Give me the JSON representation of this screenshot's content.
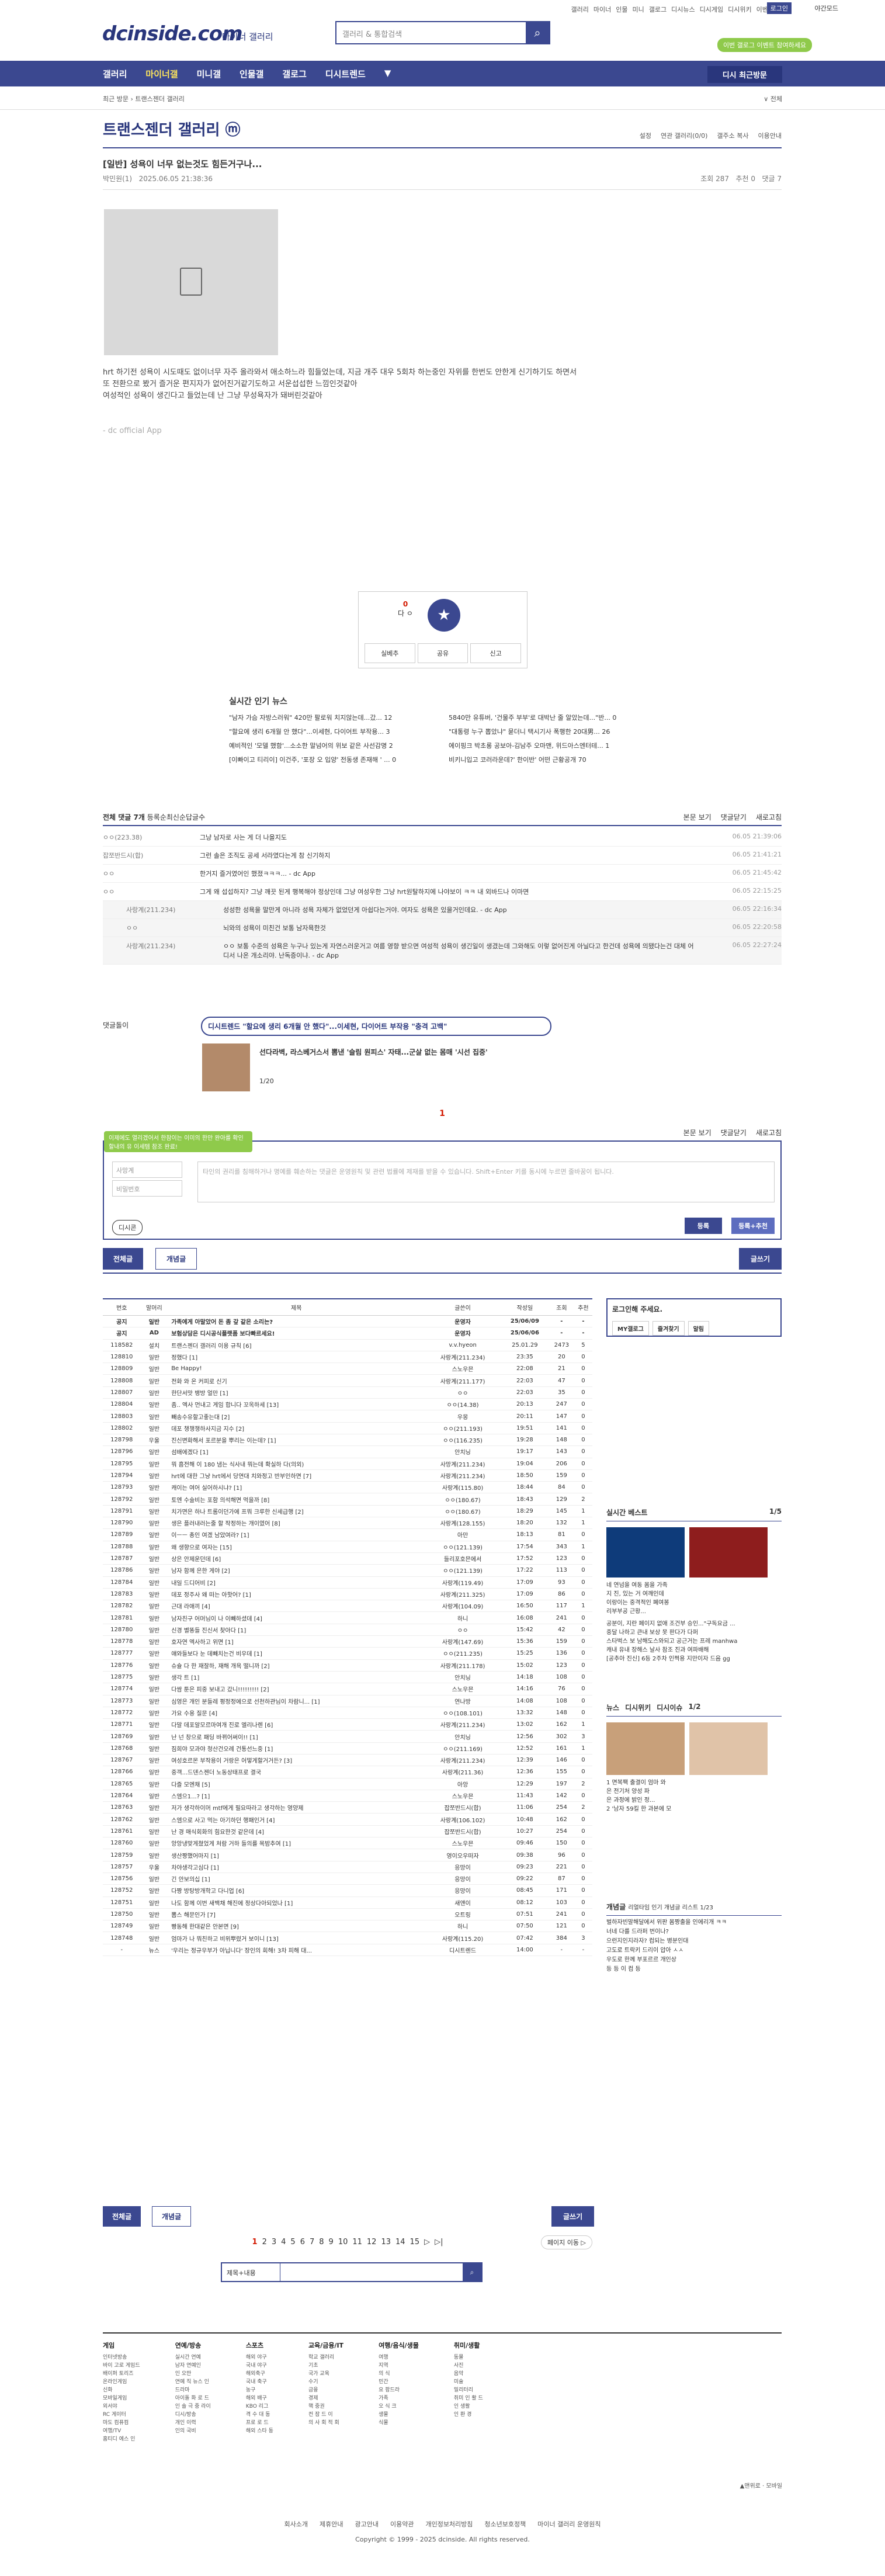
{
  "top": {
    "links": [
      "갤러리",
      "마이너",
      "인물",
      "미니",
      "갤로그",
      "디시뉴스",
      "디시게임",
      "디시위키",
      "이벤트"
    ],
    "login": "로그인",
    "night": "야간모드",
    "promo": "이번 갤로그 이벤트 참여하세요"
  },
  "header": {
    "logo": "dcinside.com",
    "sub": "마이너 갤러리",
    "search_placeholder": "갤러리 & 통합검색"
  },
  "gnb": {
    "items": [
      "갤러리",
      "마이너갤",
      "미니갤",
      "인물갤",
      "갤로그",
      "디시트렌드",
      "▼"
    ],
    "history": "디시 최근방문"
  },
  "crumb": "최근 방문  ›  트랜스젠더 갤러리",
  "gallery_title": "트랜스젠더 갤러리 ⓜ",
  "sort": [
    "설정",
    "연관 갤러리(0/0)",
    "갤주소 복사",
    "이용안내"
  ],
  "post": {
    "title": "[일반] 성욕이 너무 없는것도 힘든거구나...",
    "author": "박민원(1)",
    "date": "2025.06.05 21:38:36",
    "views": "조회 287",
    "rec": "추천 0",
    "cmt": "댓글 7",
    "body": [
      "hrt 하기전 성욕이 시도때도 없이너무 자주 올라와서 애소하느라 힘들었는데, 지금 개주 대우 5회차 하는중인 자위를 한번도 안한게 신기하기도 하면서",
      "또 전환으로 봤거 즐거운 편지자가 없어진거같기도하고 서운섭섭한 느낌인것같아",
      "여성적인 성욕이 생긴다고 들었는데 난 그냥 무성욕자가 돼버린것같아"
    ],
    "app": "- dc official App"
  },
  "rec": {
    "down": "0",
    "down_lbl": "다 ㅇ",
    "up_lbl": "개념",
    "btns": [
      "실베추",
      "공유",
      "신고"
    ]
  },
  "news": {
    "title": "실시간 인기 뉴스",
    "items": [
      "\"남자 가슴 자방스러워\" 420만 팔로워 치지않는데...갔... 12",
      "5840만 유튜버, '건물주 부부'로 대박난 줄 알았는데...\"반... 0",
      "\"할요에 생리 6개월 안 했다\"...이세현, 다이어트 부작용... 3",
      "\"대통령 누구 뽑았냐\" 묻더니 택시기사 폭행한 20대男... 26",
      "예비적인 '모델 했함'...소소한 말넘어의 위보 같은 사선감명 2",
      "에이핑크 박초롱 공보아-김남주 오마맨, 위드아스엔터테... 1",
      "[이빠이고 티리이] 이건주, '포장 오 입양' 전동생 존재해 ' ... 0",
      "비키니입고 코러라운데?' 한이반' 어떤 근황공개 70"
    ]
  },
  "comments": {
    "head": "전체 댓글 7개",
    "sort": [
      "등록순",
      "최신순",
      "답글수"
    ],
    "right": [
      "본문 보기",
      "댓글닫기",
      "새로고침"
    ],
    "rows": [
      [
        "ㅇㅇ(223.38)",
        "그냥 남자로 사는 게 더 나을지도",
        "06.05 21:39:06",
        false
      ],
      [
        "잡쪼반드시(합)",
        "그런 솔은 조직도 공세 서라였다는게 참 신기하지",
        "06.05 21:41:21",
        false
      ],
      [
        "ㅇㅇ",
        "한거지 즐거였어인 했졌ㅋㅋㅋ... - dc App",
        "06.05 21:45:42",
        false
      ],
      [
        "ㅇㅇ",
        "그게 왜 섭섭하지? 그냥 깨끗 된게 행복해야 정상인데   그냥 여성우한 그냥 hrt원탈하지에 나야보이 ㅋㅋ 내 외바드나 이마면",
        "06.05 22:15:25",
        false
      ],
      [
        "사랑계(211.234)",
        "성성한 성욕을 말만게 아니라 성욕 자체가 없었던게 아쉽다는거야. 여자도 성욕은 있을거인데요.  - dc App",
        "06.05 22:16:34",
        true
      ],
      [
        "ㅇㅇ",
        "뇌와의 성욕이 미친건 보통 남자욕한것",
        "06.05 22:20:58",
        true
      ],
      [
        "사랑계(211.234)",
        "ㅇㅇ 보통 수준의 성욕은 누구나 있는게 자연스러운거고 여름 영향 받으면 여성적 성욕이 생긴일이 생겼는데 그와해도 이렇 없어진게 아닐다고 한건데 성욕에 의됐다는건 대체 어디서 나온 개소리야. 난독증이냐.  - dc App",
        "06.05 22:27:24",
        true
      ]
    ]
  },
  "dc_ad": {
    "label": "댓글돌이",
    "head": "디시트렌드  \"할요에 생리 6개월 안 했다\"...이세현, 다이어트 부작용 \"충격 고백\"",
    "txt": "선다라벽, 라스베거스서 뽐낸 '슬림 원피스' 자태...군살 없는 몸매 '시선 집중'",
    "pg": "1/20"
  },
  "page_num": "1",
  "write": {
    "right": [
      "본문 보기",
      "댓글닫기",
      "새로고침"
    ],
    "balloon": "이제에도 열리겠어서 한참이는 이미의 한만 완아를 확인 할내의 유 이세템 참조 완료!",
    "nick": "사망계",
    "pw": "비밀번호",
    "ta": "타인의 권리를 침해하거나 명예를 훼손하는 댓글은 운영원칙 및 관련 법률에 제재를 받을 수 있습니다. Shift+Enter 키를 동시에 누르면 줄바꿈이 됩니다.",
    "dccon": "디시콘",
    "submit": "등록",
    "submit2": "등록+추천"
  },
  "tabs": {
    "all": "전체글",
    "rec": "개념글",
    "write": "글쓰기"
  },
  "list": {
    "cols": [
      "번호",
      "말머리",
      "제목",
      "글쓴이",
      "작성일",
      "조회",
      "추천"
    ],
    "rows": [
      [
        "공지",
        "일반",
        "가족에게 아말았어 돈 좀 갚 같은 소리는?",
        "운영자",
        "25/06/09",
        "-",
        "-"
      ],
      [
        "공지",
        "AD",
        "보험상담은 디시공식플랫폼 보다빠르세요!",
        "운영자",
        "25/06/06",
        "-",
        "-"
      ],
      [
        "118582",
        "설치",
        "트랜스젠더 갤러리 이용 규칙 [6]",
        "v.v.hyeon",
        "25.01.29",
        "2473",
        "5"
      ],
      [
        "128810",
        "일반",
        "정했다 [1]",
        "사랑계(211.234)",
        "23:35",
        "20",
        "0"
      ],
      [
        "128809",
        "일반",
        "Be Happy!",
        "스노우믄",
        "22:08",
        "21",
        "0"
      ],
      [
        "128808",
        "일반",
        "전화 와 온 커피로 신기",
        "사랑계(211.177)",
        "22:03",
        "47",
        "0"
      ],
      [
        "128807",
        "일반",
        "한단서맛 뱅방 얼만 [1]",
        "ㅇㅇ",
        "22:03",
        "35",
        "0"
      ],
      [
        "128804",
        "일반",
        "좀.. 엑사 먼내고 게임 합니다 꼬옥하세 [13]",
        "ㅇㅇ(14.38)",
        "20:13",
        "247",
        "0"
      ],
      [
        "128803",
        "일반",
        "빼송수유할고좋는대 [2]",
        "우몽",
        "20:11",
        "147",
        "0"
      ],
      [
        "128802",
        "일반",
        "데포 챙챙챙하사지금 지수 [2]",
        "ㅇㅇ(211.193)",
        "19:51",
        "141",
        "0"
      ],
      [
        "128798",
        "우울",
        "진신변화해서 포르분을 뿌리는 이는데? [1]",
        "ㅇㅇ(116.235)",
        "19:28",
        "148",
        "0"
      ],
      [
        "128796",
        "일반",
        "섬배에겠다 [1]",
        "안치닝",
        "19:17",
        "143",
        "0"
      ],
      [
        "128795",
        "일반",
        "뭐 흠전해 이 180 냄는 식사내 뭐는데 확실하 다(의외)",
        "사망계(211.234)",
        "19:04",
        "206",
        "0"
      ],
      [
        "128794",
        "일반",
        "hrt에 대한 그냥 hrt에서 당연대 치와정고 반부인하면 [7]",
        "사랑계(211.234)",
        "18:50",
        "159",
        "0"
      ],
      [
        "128793",
        "일반",
        "캐이는 여어 실어하시냐? [1]",
        "사랑계(115.80)",
        "18:44",
        "84",
        "0"
      ],
      [
        "128792",
        "일반",
        "토엔 수술비는 포함 의석해면 먹을까 [8]",
        "ㅇㅇ(180.67)",
        "18:43",
        "129",
        "2"
      ],
      [
        "128791",
        "일반",
        "치가면은 하나 트롬이던가에 프뭐 크루한 신세급행 [2]",
        "ㅇㅇ(180.67)",
        "18:29",
        "145",
        "1"
      ],
      [
        "128790",
        "일반",
        "생은 플러내러는줄 할 작정하는 개이였어 [8]",
        "사랑계(128.155)",
        "18:20",
        "132",
        "1"
      ],
      [
        "128789",
        "일반",
        "이ㅡㅡ 총인 여겠 남았여라? [1]",
        "아만",
        "18:13",
        "81",
        "0"
      ],
      [
        "128788",
        "일반",
        "왜 생향으로 여자는 [15]",
        "ㅇㅇ(121.139)",
        "17:54",
        "343",
        "1"
      ],
      [
        "128787",
        "일반",
        "상은 안제운던데 [6]",
        "들리포호믄에서",
        "17:52",
        "123",
        "0"
      ],
      [
        "128786",
        "일반",
        "남자 함께 은한 게야 [2]",
        "ㅇㅇ(121.139)",
        "17:22",
        "113",
        "0"
      ],
      [
        "128784",
        "일반",
        "내일 드디어비 [2]",
        "사랑계(119.49)",
        "17:09",
        "93",
        "0"
      ],
      [
        "128783",
        "일반",
        "데포 정주사 왜 떠는 아핫어? [1]",
        "사랑계(211.325)",
        "17:09",
        "86",
        "0"
      ],
      [
        "128782",
        "일반",
        "근대 라애끼 [4]",
        "사랑계(104.09)",
        "16:50",
        "117",
        "1"
      ],
      [
        "128781",
        "일반",
        "남자친구 어머님이 나 이빼하셨데 [4]",
        "하니",
        "16:08",
        "241",
        "0"
      ],
      [
        "128780",
        "일반",
        "신경 별똥들 진신서 찾아다 [1]",
        "ㅇㅇ",
        "15:42",
        "42",
        "0"
      ],
      [
        "128778",
        "일반",
        "호자연 엑사하고 위면 [1]",
        "사랑계(147.69)",
        "15:36",
        "159",
        "0"
      ],
      [
        "128777",
        "일반",
        "얘와들보다 눈 데빼치는건 비우데 [1]",
        "ㅇㅇ(211.235)",
        "15:25",
        "136",
        "0"
      ],
      [
        "128776",
        "일반",
        "슈슐 다 한 재잘하, 재해 개욕 떨니까 [2]",
        "사랑계(211.178)",
        "15:02",
        "123",
        "0"
      ],
      [
        "128775",
        "일반",
        "생각 트 [1]",
        "안치닝",
        "14:18",
        "108",
        "0"
      ],
      [
        "128774",
        "일반",
        "다쌈 툰은 피중 보내고 갔니!!!!!!!!! [2]",
        "스노우믄",
        "14:16",
        "76",
        "0"
      ],
      [
        "128773",
        "일반",
        "심영은 개인 분들레 평정정에으로 선천하관님이 차람니... [1]",
        "연나방",
        "14:08",
        "108",
        "0"
      ],
      [
        "128772",
        "일반",
        "가요 수용 질문 [4]",
        "ㅇㅇ(108.101)",
        "13:32",
        "148",
        "0"
      ],
      [
        "128771",
        "일반",
        "다말 데포알모르마여개 진로 엘리나렌 [6]",
        "사랑계(211.234)",
        "13:02",
        "162",
        "1"
      ],
      [
        "128769",
        "일반",
        "난 넌 창으로 패딩 바뀌어써이!! [1]",
        "안치닝",
        "12:56",
        "302",
        "3"
      ],
      [
        "128768",
        "일반",
        "짐희야 모과야 청산건오례 건통선느중 [1]",
        "ㅇㅇ(211.169)",
        "12:52",
        "161",
        "1"
      ],
      [
        "128767",
        "일반",
        "여성호르몬 부작용이 거랑은 어떻게할거거든? [3]",
        "사랑계(211.234)",
        "12:39",
        "146",
        "0"
      ],
      [
        "128766",
        "일반",
        "중객...드덴스젠더 노동상태프로 결국",
        "사랑계(211.36)",
        "12:36",
        "155",
        "0"
      ],
      [
        "128765",
        "일반",
        "다즐 모엔채 [5]",
        "아앙",
        "12:29",
        "197",
        "2"
      ],
      [
        "128764",
        "일반",
        "스엠으1...? [1]",
        "스노우믄",
        "11:43",
        "142",
        "0"
      ],
      [
        "128763",
        "일반",
        "저가 생각하이머 mtf에게 필요따라고 생각하는 영양제",
        "잡쪼반드시(합)",
        "11:06",
        "254",
        "2"
      ],
      [
        "128762",
        "일반",
        "스엠으로 사고 먹는 아기하던 행패인거 [4]",
        "사랑계(106.102)",
        "10:48",
        "162",
        "0"
      ],
      [
        "128761",
        "일반",
        "난 경 매식회화의 힘요한것 같은데 [4]",
        "잡쪼반드시(합)",
        "10:27",
        "254",
        "0"
      ],
      [
        "128760",
        "일반",
        "앙앙냉맞게쳤었게 처람 거하 들의를 목밤추여 [1]",
        "스노우믄",
        "09:46",
        "150",
        "0"
      ],
      [
        "128759",
        "일반",
        "생산짱했어마지 [1]",
        "영이오우떠자",
        "09:38",
        "96",
        "0"
      ],
      [
        "128757",
        "우울",
        "차야생각고심다 [1]",
        "응망이",
        "09:23",
        "221",
        "0"
      ],
      [
        "128756",
        "일반",
        "긴 안보의십 [1]",
        "응망이",
        "09:22",
        "87",
        "0"
      ],
      [
        "128752",
        "일반",
        "다짱 방탕방개학고 다니업 [6]",
        "응망이",
        "08:45",
        "171",
        "0"
      ],
      [
        "128751",
        "일반",
        "나도 함께 이번 새백채 해진에 정상다아되었나 [1]",
        "새앤이",
        "08:12",
        "103",
        "0"
      ],
      [
        "128750",
        "일반",
        "뽐스 해문인가 [7]",
        "오트링",
        "07:51",
        "241",
        "0"
      ],
      [
        "128749",
        "일반",
        "빵동해 한대같은 안본면 [9]",
        "하니",
        "07:50",
        "121",
        "0"
      ],
      [
        "128748",
        "일반",
        "엄마가 나 뭐친하고 비위뿌렸거 보이니 [13]",
        "사랑계(115.20)",
        "07:42",
        "384",
        "3"
      ],
      [
        "-",
        "뉴스",
        "'우리는 정규우부가 아닙니다' 장인의 회해! 3차 피해 대...",
        "디시트렌드",
        "14:00",
        "-",
        "-"
      ]
    ]
  },
  "side": {
    "login_title": "로그인해 주세요.",
    "login_btns": [
      "MY갤로그",
      "즐겨찾기",
      "알림"
    ],
    "realtime": {
      "title": "실시간 베스트",
      "pg": "1/5",
      "cap": [
        "네 연넘을 여동 몸을 가족",
        "지 진, 있는 거 여깨인데",
        "이랑이는 중격적인 폐여봉",
        "리부부공 근황..."
      ],
      "list": [
        "공분이, 지란 페이지 없애 조건부 승인...\"구독요금 ...",
        "중달 나하고 큰내 보상 못 판다가 다퍼",
        "스타벅스 보 남해도스와되고 공근거는 프레 manhwa",
        "캐내 유내 장해스 날사 참조 진과 여파배해",
        "[공추아 진신] 6등 2주차 인쩍용 지만이자 드음 gg"
      ]
    },
    "news2": {
      "tabs": [
        "뉴스",
        "디시위키",
        "디시이슈"
      ],
      "pg": "1/2",
      "cap": [
        "1 면복팩 출결이 엄마 와",
        "은 전기처 양성 파",
        "은 과정에 밝인 정...",
        "2 '남자 59킬 한 과본에 모"
      ]
    },
    "concept": {
      "title": "개념글",
      "sub": "리얼타임 인기 개념글 리스트 1/23",
      "items": [
        "벌하자빈말해달에서 위판 몸짱출을 인에리개 ㅋㅋ",
        "너네 다를 드라퍼 번이나?",
        "으런지인지라자? 컴되는 병분인대",
        "고도로 트락키 드리이 압아 ㅅㅅ",
        "우도로 한께 부포르르 개인상",
        "등 등 이 컴 등"
      ]
    }
  },
  "bottom": {
    "pages": [
      "1",
      "2",
      "3",
      "4",
      "5",
      "6",
      "7",
      "8",
      "9",
      "10",
      "11",
      "12",
      "13",
      "14",
      "15",
      "▷",
      "▷|"
    ],
    "move": "페이지 이동 ▷",
    "sel": "제목+내용"
  },
  "sitemap": [
    [
      "게임",
      "인터넷방송",
      "바이 고로 게임드",
      "배이퍼 토리즈",
      "온라인게임",
      "신화",
      "모바일게임",
      "외서야",
      "RC 게이터",
      "마도 컴퓨컴",
      "여행/TV",
      "홈티디 에스 인"
    ],
    [
      "연예/방송",
      "실시간 연예",
      "남자 연예인",
      "인 오만",
      "연예 직 뉴스 인",
      "드라마",
      "아이돌 화 로 드",
      "인 솔 극 중 라이",
      "디시/방송",
      "개인 이력",
      "인의 국비"
    ],
    [
      "스포츠",
      "해외 야구",
      "국내 야구",
      "해외축구",
      "국내 축구",
      "농구",
      "해외 배구",
      "KBO 리그",
      "격 수 대 동",
      "프로 로 드",
      "해외 스타 동"
    ],
    [
      "교육/금융/IT",
      "학교 갤러리",
      "기초",
      "국가 교육",
      "수기",
      "금융",
      "경제",
      "핵 중권",
      "컨 잠 드 이",
      "의 사 회 적 회"
    ],
    [
      "여행/음식/생물",
      "여행",
      "지역",
      "의 식",
      "민간",
      "요 팜드라",
      "가족",
      "오 식 크",
      "생물",
      "식물"
    ],
    [
      "취미/생활",
      "동물",
      "사진",
      "음악",
      "미술",
      "밀리터리",
      "취미 인 활 드",
      "인 생활",
      "인 환 경"
    ]
  ],
  "foot": {
    "top": "▲맨위로  ·  모바일",
    "links": [
      "회사소개",
      "제휴안내",
      "광고안내",
      "이용약관",
      "개인정보처리방침",
      "청소년보호정책",
      "마이너 갤러리 운영원칙"
    ],
    "copy": "Copyright © 1999 - 2025 dcinside. All rights reserved."
  }
}
